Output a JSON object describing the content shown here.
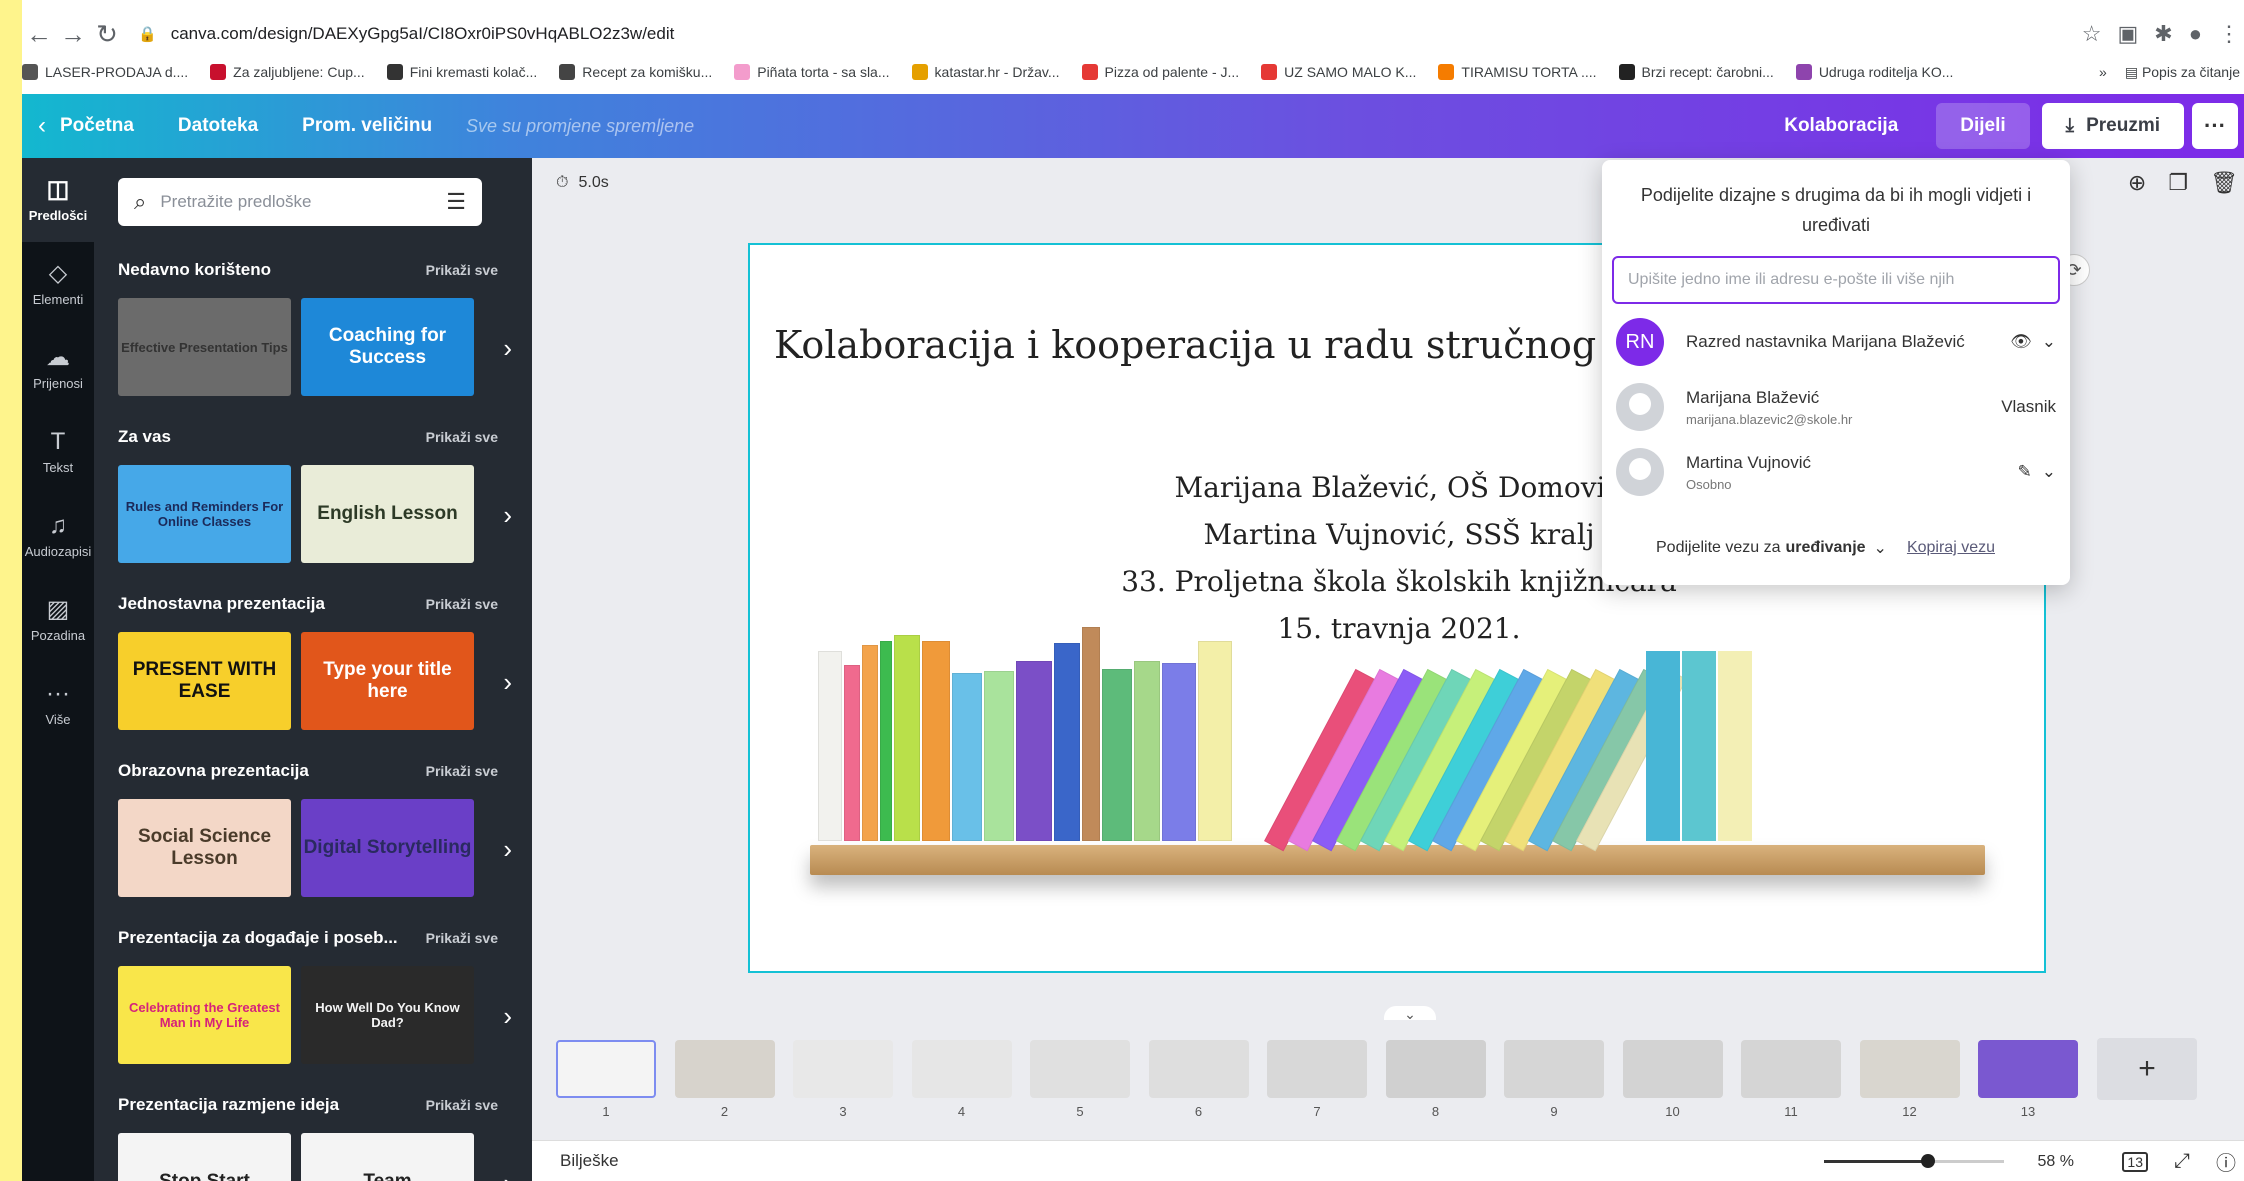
{
  "browser": {
    "url": "canva.com/design/DAEXyGpg5aI/CI8Oxr0iPS0vHqABLO2z3w/edit",
    "reading_list": "Popis za čitanje",
    "bookmarks": [
      {
        "label": "LASER-PRODAJA d....",
        "color": "#555"
      },
      {
        "label": "Za zaljubljene: Cup...",
        "color": "#c8102e"
      },
      {
        "label": "Fini kremasti kolač...",
        "color": "#333"
      },
      {
        "label": "Recept za komišku...",
        "color": "#444"
      },
      {
        "label": "Piñata torta - sa sla...",
        "color": "#f39ccc"
      },
      {
        "label": "katastar.hr - Držav...",
        "color": "#e5a000"
      },
      {
        "label": "Pizza od palente - J...",
        "color": "#e53935"
      },
      {
        "label": "UZ SAMO MALO K...",
        "color": "#e53935"
      },
      {
        "label": "TIRAMISU TORTA ....",
        "color": "#f57c00"
      },
      {
        "label": "Brzi recept: čarobni...",
        "color": "#222"
      },
      {
        "label": "Udruga roditelja KO...",
        "color": "#8e44ad"
      }
    ]
  },
  "topbar": {
    "home": "Početna",
    "file": "Datoteka",
    "resize": "Prom. veličinu",
    "saved": "Sve su promjene spremljene",
    "collab": "Kolaboracija",
    "share": "Dijeli",
    "download": "Preuzmi"
  },
  "rail": [
    {
      "label": "Predlošci",
      "icon": "templates-icon"
    },
    {
      "label": "Elementi",
      "icon": "elements-icon"
    },
    {
      "label": "Prijenosi",
      "icon": "uploads-icon"
    },
    {
      "label": "Tekst",
      "icon": "text-icon"
    },
    {
      "label": "Audiozapisi",
      "icon": "audio-icon"
    },
    {
      "label": "Pozadina",
      "icon": "background-icon"
    },
    {
      "label": "Više",
      "icon": "more-icon"
    }
  ],
  "panel": {
    "search_placeholder": "Pretražite predloške",
    "see_all": "Prikaži sve",
    "sections": [
      {
        "title": "Nedavno korišteno",
        "thumbs": [
          {
            "text": "Effective Presentation Tips",
            "bg": "#6b6b6b",
            "fg": "#333"
          },
          {
            "text": "Coaching for Success",
            "bg": "#1e88d8",
            "fg": "#fff"
          }
        ]
      },
      {
        "title": "Za vas",
        "thumbs": [
          {
            "text": "Rules and Reminders For Online Classes",
            "bg": "#46a8e8",
            "fg": "#1b2a5a"
          },
          {
            "text": "English Lesson",
            "bg": "#e9ecd8",
            "fg": "#2d3a26"
          }
        ]
      },
      {
        "title": "Jednostavna prezentacija",
        "thumbs": [
          {
            "text": "PRESENT WITH EASE",
            "bg": "#f7cf2b",
            "fg": "#111"
          },
          {
            "text": "Type your title here",
            "bg": "#e1561b",
            "fg": "#fff"
          }
        ]
      },
      {
        "title": "Obrazovna prezentacija",
        "thumbs": [
          {
            "text": "Social Science Lesson",
            "bg": "#f3d7c7",
            "fg": "#4a3b2a"
          },
          {
            "text": "Digital Storytelling",
            "bg": "#6a3fc7",
            "fg": "#2a2a60"
          }
        ]
      },
      {
        "title": "Prezentacija za događaje i poseb...",
        "thumbs": [
          {
            "text": "Celebrating the Greatest Man in My Life",
            "bg": "#f9e64a",
            "fg": "#d6227a"
          },
          {
            "text": "How Well Do You Know Dad?",
            "bg": "#2a2a2a",
            "fg": "#f4f4f4"
          }
        ]
      },
      {
        "title": "Prezentacija razmjene ideja",
        "thumbs": [
          {
            "text": "Stop Start",
            "bg": "#f4f4f4",
            "fg": "#222"
          },
          {
            "text": "Team",
            "bg": "#f4f4f4",
            "fg": "#222"
          }
        ]
      }
    ]
  },
  "editor": {
    "duration": "5.0s",
    "notes": "Bilješke",
    "zoom": "58 %",
    "zoom_fraction": 0.58,
    "page_count": "13"
  },
  "slide": {
    "title": "Kolaboracija i kooperacija u radu stručnog s",
    "lines": [
      "Marijana Blažević, OŠ Domovin",
      "Martina Vujnović, SSŠ kralj",
      "33. Proljetna škola školskih knjižničara",
      "15. travnja 2021."
    ],
    "books": [
      "#f2f2ee",
      "#f06a8e",
      "#f3a34b",
      "#3dbb4f",
      "#b9e04a",
      "#f09a3a",
      "#69c0e8",
      "#a9e39c",
      "#7b4fc7",
      "#3a66c9",
      "#c08a5a",
      "#5dbb7a",
      "#a6d88a",
      "#7b7de8",
      "#f3efa8"
    ],
    "leaning": [
      "#e94f7a",
      "#e87be0",
      "#8b5cf6",
      "#9ae37a",
      "#6fd6b8",
      "#c6f07a",
      "#3ecfd8",
      "#5fa8e8",
      "#e5f07a",
      "#c4d46a",
      "#f0e07a",
      "#5db6e0",
      "#86c7a8",
      "#e8e2b5"
    ]
  },
  "share_popup": {
    "description": "Podijelite dizajne s drugima da bi ih mogli vidjeti i uređivati",
    "input_placeholder": "Upišite jedno ime ili adresu e-pošte ili više njih",
    "people": [
      {
        "initials": "RN",
        "name": "Razred nastavnika Marijana Blažević",
        "sub": "",
        "role": "",
        "color": "#7d2ae8"
      },
      {
        "initials": "",
        "name": "Marijana Blažević",
        "sub": "marijana.blazevic2@skole.hr",
        "role": "Vlasnik",
        "color": ""
      },
      {
        "initials": "",
        "name": "Martina Vujnović",
        "sub": "Osobno",
        "role": "",
        "color": ""
      }
    ],
    "footer_prefix": "Podijelite vezu za",
    "footer_mode": "uređivanje",
    "copy_link": "Kopiraj vezu"
  },
  "pages": [
    {
      "num": "1",
      "bg": "#f4f4f4"
    },
    {
      "num": "2",
      "bg": "#d7d3cc"
    },
    {
      "num": "3",
      "bg": "#e8e8e8"
    },
    {
      "num": "4",
      "bg": "#e6e6e6"
    },
    {
      "num": "5",
      "bg": "#e0e0e0"
    },
    {
      "num": "6",
      "bg": "#dedede"
    },
    {
      "num": "7",
      "bg": "#d8d8d8"
    },
    {
      "num": "8",
      "bg": "#d0d0d0"
    },
    {
      "num": "9",
      "bg": "#d6d6d6"
    },
    {
      "num": "10",
      "bg": "#d3d3d3"
    },
    {
      "num": "11",
      "bg": "#d5d5d5"
    },
    {
      "num": "12",
      "bg": "#d9d6cf"
    },
    {
      "num": "13",
      "bg": "#7a58d0"
    }
  ]
}
